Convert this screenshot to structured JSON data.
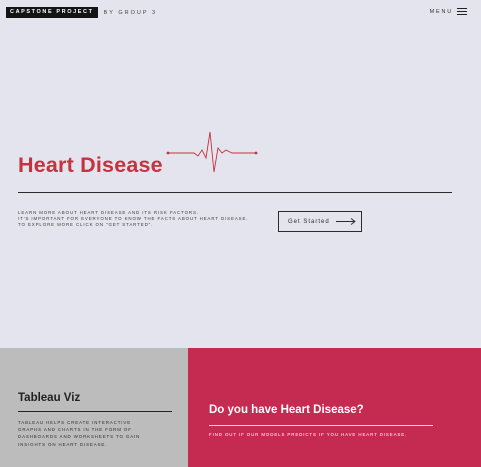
{
  "header": {
    "brand": "CAPSTONE PROJECT",
    "byline": "BY GROUP 3",
    "menu_label": "MENU",
    "menu_icon": "hamburger-icon"
  },
  "hero": {
    "title": "Heart Disease",
    "graphic_icon": "heartbeat-pulse-icon",
    "description": [
      "LEARN MORE ABOUT HEART DISEASE AND ITS RISK FACTORS.",
      "IT'S IMPORTANT FOR EVERYONE TO KNOW THE FACTS ABOUT HEART DISEASE.",
      "TO EXPLORE MORE CLICK ON \"GET STARTED\"."
    ],
    "cta_label": "Get Started",
    "cta_icon": "long-arrow-right-icon"
  },
  "tableau": {
    "title": "Tableau Viz",
    "description": [
      "TABLEAU HELPS CREATE INTERACTIVE",
      "GRAPHS AND CHARTS IN THE FORM OF",
      "DASHBOARDS AND WORKSHEETS TO GAIN",
      "INSIGHTS ON HEART DISEASE."
    ]
  },
  "predict": {
    "title": "Do you have Heart Disease?",
    "description": "FIND OUT IF OUR MODELS PREDICTS IF YOU HAVE HEART DISEASE."
  },
  "colors": {
    "background": "#e4e4ee",
    "accent_red": "#c8313f",
    "panel_crimson": "#c52b50",
    "panel_gray": "#bcbcbc",
    "ink": "#2a2a2a"
  }
}
